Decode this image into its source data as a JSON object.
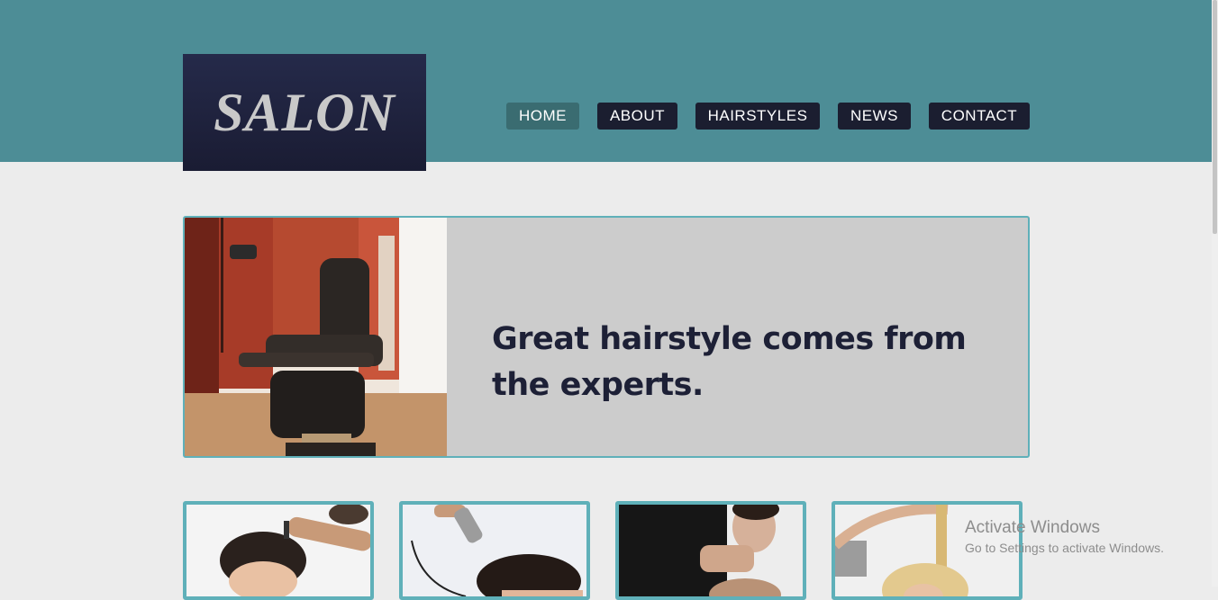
{
  "logo": {
    "text": "SALON"
  },
  "nav": {
    "items": [
      {
        "label": "HOME",
        "active": true
      },
      {
        "label": "ABOUT",
        "active": false
      },
      {
        "label": "HAIRSTYLES",
        "active": false
      },
      {
        "label": "NEWS",
        "active": false
      },
      {
        "label": "CONTACT",
        "active": false
      }
    ]
  },
  "hero": {
    "headline": "Great hairstyle comes from the experts.",
    "image": "barber-chair-photo"
  },
  "cards": [
    {
      "image": "man-haircut-photo"
    },
    {
      "image": "clipper-haircut-photo"
    },
    {
      "image": "stylist-washing-hair-photo"
    },
    {
      "image": "blonde-hair-styling-photo"
    }
  ],
  "watermark": {
    "title": "Activate Windows",
    "subtitle": "Go to Settings to activate Windows."
  },
  "colors": {
    "header": "#4d8d96",
    "logo_bg": "#1f2240",
    "nav_bg": "#1b1e30",
    "nav_active": "#3a6c71",
    "accent_border": "#5fb0b9",
    "page_bg": "#ececec"
  }
}
